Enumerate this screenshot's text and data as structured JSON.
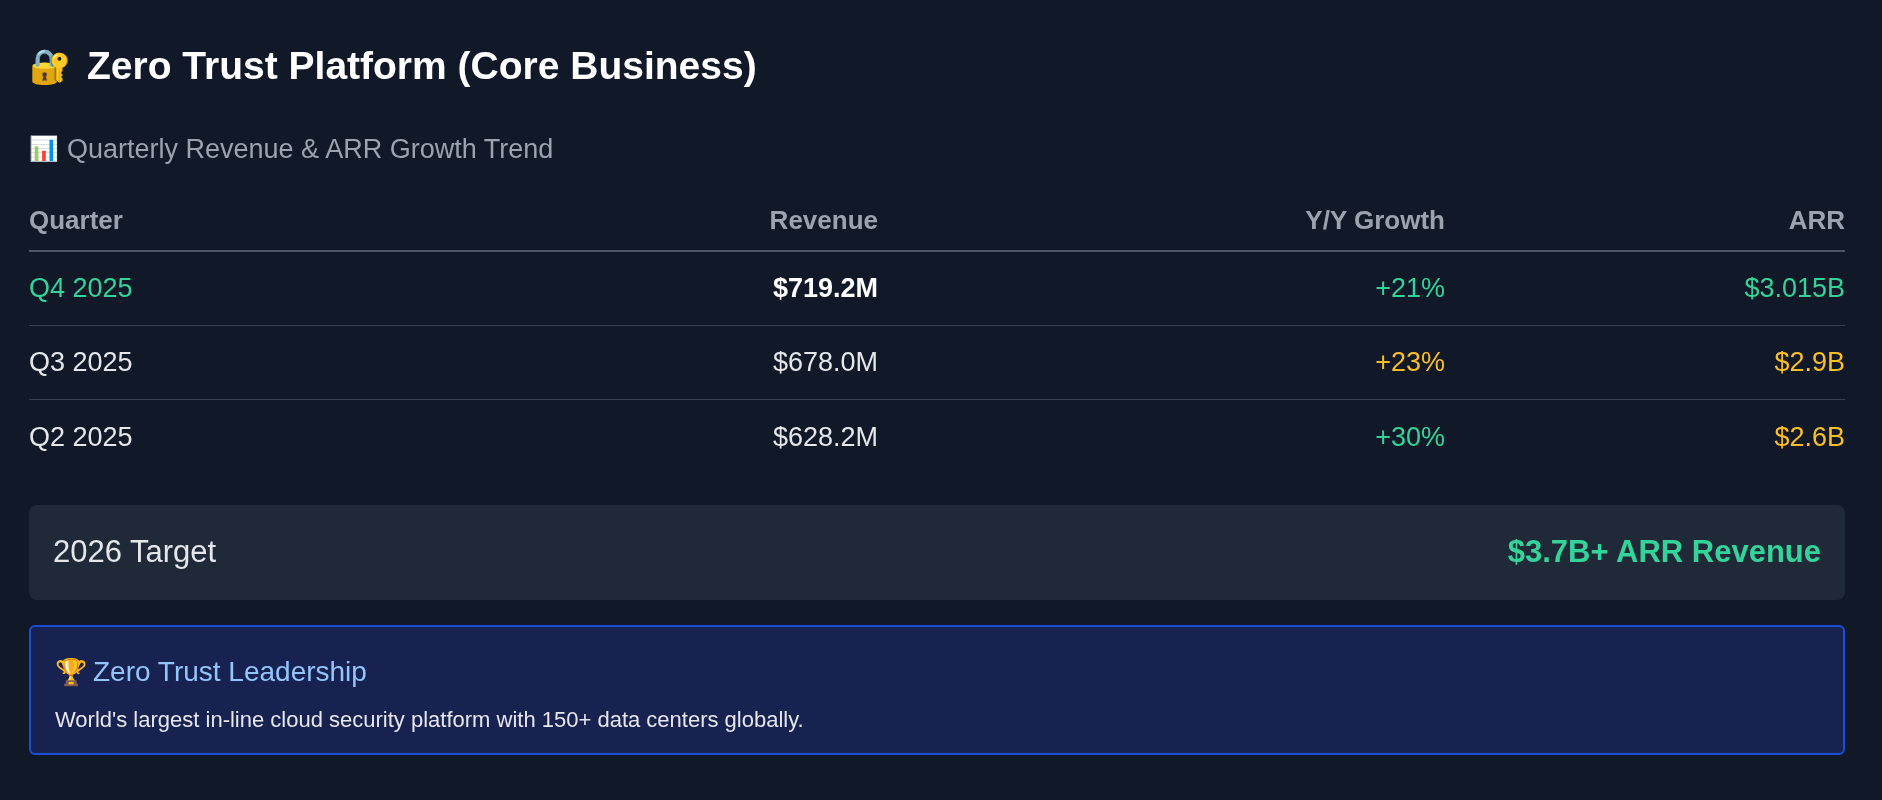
{
  "title": {
    "icon": "🔐",
    "text": "Zero Trust Platform (Core Business)"
  },
  "subtitle": {
    "icon": "📊",
    "text": "Quarterly Revenue & ARR Growth Trend"
  },
  "table": {
    "columns": [
      "Quarter",
      "Revenue",
      "Y/Y Growth",
      "ARR"
    ],
    "rows": [
      {
        "quarter": "Q4 2025",
        "revenue": "$719.2M",
        "growth": {
          "text": "+21%",
          "color": "#34d399"
        },
        "arr": {
          "text": "$3.015B",
          "color": "#34d399"
        },
        "selected": true
      },
      {
        "quarter": "Q3 2025",
        "revenue": "$678.0M",
        "growth": {
          "text": "+23%",
          "color": "#fbbf24"
        },
        "arr": {
          "text": "$2.9B",
          "color": "#fbbf24"
        },
        "selected": false
      },
      {
        "quarter": "Q2 2025",
        "revenue": "$628.2M",
        "growth": {
          "text": "+30%",
          "color": "#34d399"
        },
        "arr": {
          "text": "$2.6B",
          "color": "#fbbf24"
        },
        "selected": false
      }
    ]
  },
  "target": {
    "label": "2026 Target",
    "value": "$3.7B+ ARR Revenue"
  },
  "callout": {
    "icon": "🏆",
    "title": "Zero Trust Leadership",
    "text": "World's largest in-line cloud security platform with 150+ data centers globally."
  }
}
